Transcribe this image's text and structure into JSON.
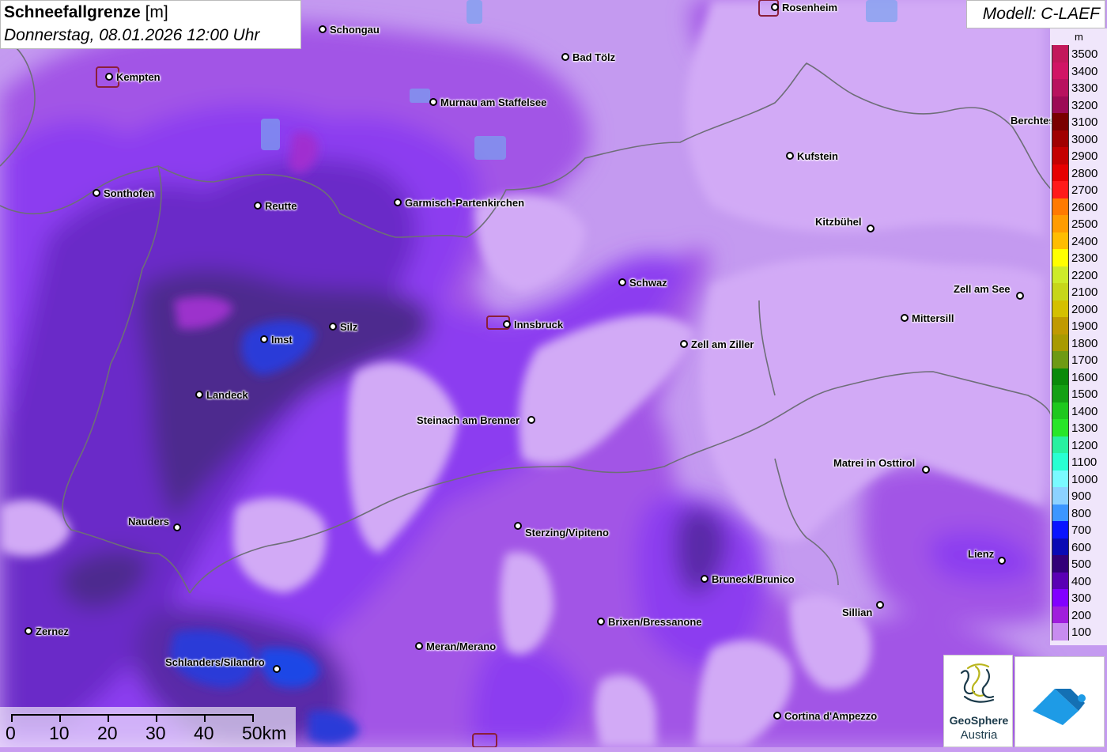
{
  "header": {
    "title": "Schneefallgrenze",
    "unit": "[m]",
    "datetime": "Donnerstag, 08.01.2026 12:00 Uhr",
    "model": "Modell: C-LAEF"
  },
  "legend": {
    "unit": "m",
    "items": [
      {
        "value": "3500",
        "color": "#c2185b"
      },
      {
        "value": "3400",
        "color": "#d11565"
      },
      {
        "value": "3300",
        "color": "#b8125e"
      },
      {
        "value": "3200",
        "color": "#9c0b55"
      },
      {
        "value": "3100",
        "color": "#7a0000"
      },
      {
        "value": "3000",
        "color": "#a00000"
      },
      {
        "value": "2900",
        "color": "#c40000"
      },
      {
        "value": "2800",
        "color": "#e60000"
      },
      {
        "value": "2700",
        "color": "#ff1a1a"
      },
      {
        "value": "2600",
        "color": "#ff7a00"
      },
      {
        "value": "2500",
        "color": "#ff9c00"
      },
      {
        "value": "2400",
        "color": "#ffbd00"
      },
      {
        "value": "2300",
        "color": "#ffff00"
      },
      {
        "value": "2200",
        "color": "#cdeb2a"
      },
      {
        "value": "2100",
        "color": "#c7d61a"
      },
      {
        "value": "2000",
        "color": "#d4c000"
      },
      {
        "value": "1900",
        "color": "#c09a00"
      },
      {
        "value": "1800",
        "color": "#a89a00"
      },
      {
        "value": "1700",
        "color": "#6e9a14"
      },
      {
        "value": "1600",
        "color": "#0a8a0a"
      },
      {
        "value": "1500",
        "color": "#14a014"
      },
      {
        "value": "1400",
        "color": "#1ec81e"
      },
      {
        "value": "1300",
        "color": "#28e628"
      },
      {
        "value": "1200",
        "color": "#28f0a0"
      },
      {
        "value": "1100",
        "color": "#28ffd2"
      },
      {
        "value": "1000",
        "color": "#7afaff"
      },
      {
        "value": "900",
        "color": "#8cd2ff"
      },
      {
        "value": "800",
        "color": "#3c96ff"
      },
      {
        "value": "700",
        "color": "#0a14ff"
      },
      {
        "value": "600",
        "color": "#0a0ab4"
      },
      {
        "value": "500",
        "color": "#320078"
      },
      {
        "value": "400",
        "color": "#5a00b4"
      },
      {
        "value": "300",
        "color": "#8200ff"
      },
      {
        "value": "200",
        "color": "#a01edc"
      },
      {
        "value": "100",
        "color": "#c88cf0"
      }
    ]
  },
  "cities": [
    {
      "name": "Rosenheim"
    },
    {
      "name": "Schongau"
    },
    {
      "name": "Kempten"
    },
    {
      "name": "Bad Tölz"
    },
    {
      "name": "Murnau am Staffelsee"
    },
    {
      "name": "Kufstein"
    },
    {
      "name": "Berchtes"
    },
    {
      "name": "Sonthofen"
    },
    {
      "name": "Reutte"
    },
    {
      "name": "Garmisch-Partenkirchen"
    },
    {
      "name": "Kitzbühel"
    },
    {
      "name": "Schwaz"
    },
    {
      "name": "Zell am See"
    },
    {
      "name": "Mittersill"
    },
    {
      "name": "Imst"
    },
    {
      "name": "Silz"
    },
    {
      "name": "Innsbruck"
    },
    {
      "name": "Zell am Ziller"
    },
    {
      "name": "Landeck"
    },
    {
      "name": "Steinach am Brenner"
    },
    {
      "name": "Matrei in Osttirol"
    },
    {
      "name": "Nauders"
    },
    {
      "name": "Sterzing/Vipiteno"
    },
    {
      "name": "Lienz"
    },
    {
      "name": "Bruneck/Brunico"
    },
    {
      "name": "Sillian"
    },
    {
      "name": "Zernez"
    },
    {
      "name": "Brixen/Bressanone"
    },
    {
      "name": "Meran/Merano"
    },
    {
      "name": "Schlanders/Silandro"
    },
    {
      "name": "Cortina d'Ampezzo"
    }
  ],
  "scale": {
    "labels": [
      "0",
      "10",
      "20",
      "30",
      "40",
      "50km"
    ]
  },
  "logos": {
    "geosphere_name": "GeoSphere",
    "geosphere_sub": "Austria"
  }
}
